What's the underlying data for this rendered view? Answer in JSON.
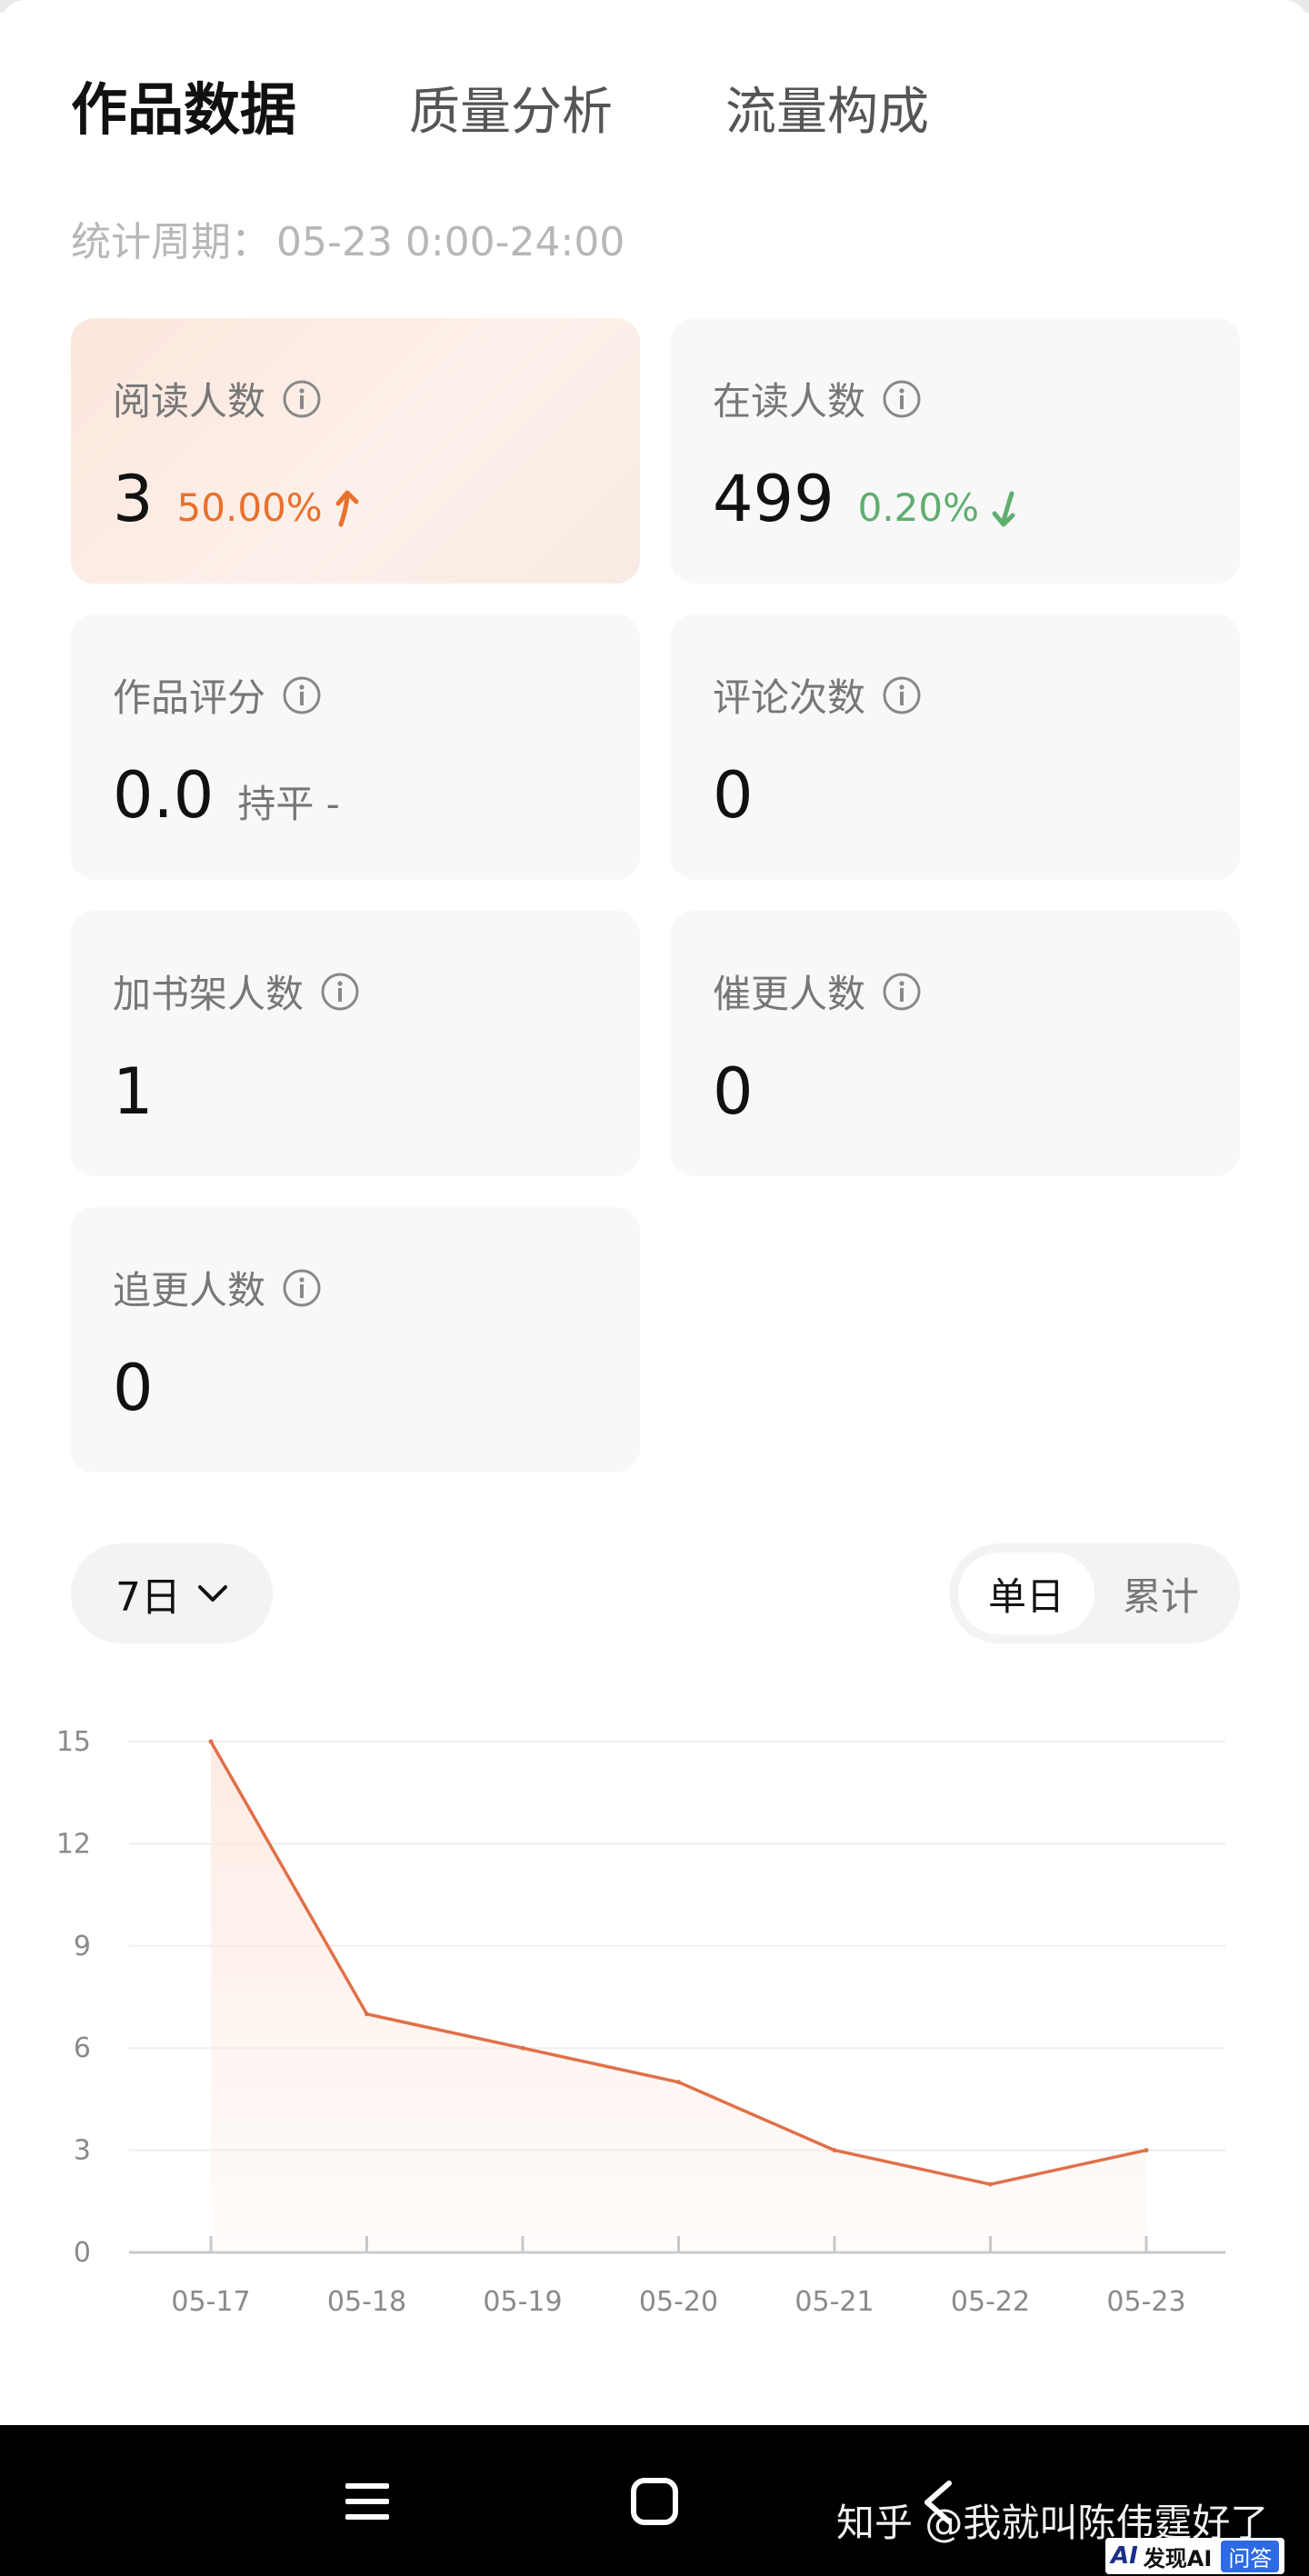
{
  "tabs": [
    {
      "label": "作品数据",
      "active": true
    },
    {
      "label": "质量分析",
      "active": false
    },
    {
      "label": "流量构成",
      "active": false
    }
  ],
  "period": {
    "label": "统计周期：",
    "value": "05-23 0:00-24:00"
  },
  "cards": [
    {
      "label": "阅读人数",
      "value": "3",
      "change": "50.00%",
      "trend": "up",
      "icon": "info-icon"
    },
    {
      "label": "在读人数",
      "value": "499",
      "change": "0.20%",
      "trend": "down",
      "icon": "info-icon"
    },
    {
      "label": "作品评分",
      "value": "0.0",
      "change": "持平 -",
      "trend": "flat",
      "icon": "info-icon"
    },
    {
      "label": "评论次数",
      "value": "0",
      "icon": "info-icon"
    },
    {
      "label": "加书架人数",
      "value": "1",
      "icon": "info-icon"
    },
    {
      "label": "催更人数",
      "value": "0",
      "icon": "info-icon"
    },
    {
      "label": "追更人数",
      "value": "0",
      "icon": "info-icon"
    }
  ],
  "controls": {
    "range": "7日",
    "range_icon": "chevron-down-icon",
    "toggle": {
      "selected": "单日",
      "other": "累计"
    }
  },
  "chart_data": {
    "type": "area",
    "categories": [
      "05-17",
      "05-18",
      "05-19",
      "05-20",
      "05-21",
      "05-22",
      "05-23"
    ],
    "values": [
      15,
      7,
      6,
      5,
      3,
      2,
      3
    ],
    "yticks": [
      0,
      3,
      6,
      9,
      12,
      15
    ],
    "ylim": [
      0,
      15
    ],
    "grid": true,
    "line_color": "#e07048",
    "fill_color": "#fde9e1"
  },
  "navbar": {
    "watermark": "知乎 @我就叫陈伟霆好了",
    "badge": {
      "ai": "AI",
      "text": "发现AI",
      "question": "问答"
    }
  },
  "colors": {
    "up": "#e8712c",
    "down": "#5fae6f",
    "highlight_card": "#fbe6dc"
  }
}
